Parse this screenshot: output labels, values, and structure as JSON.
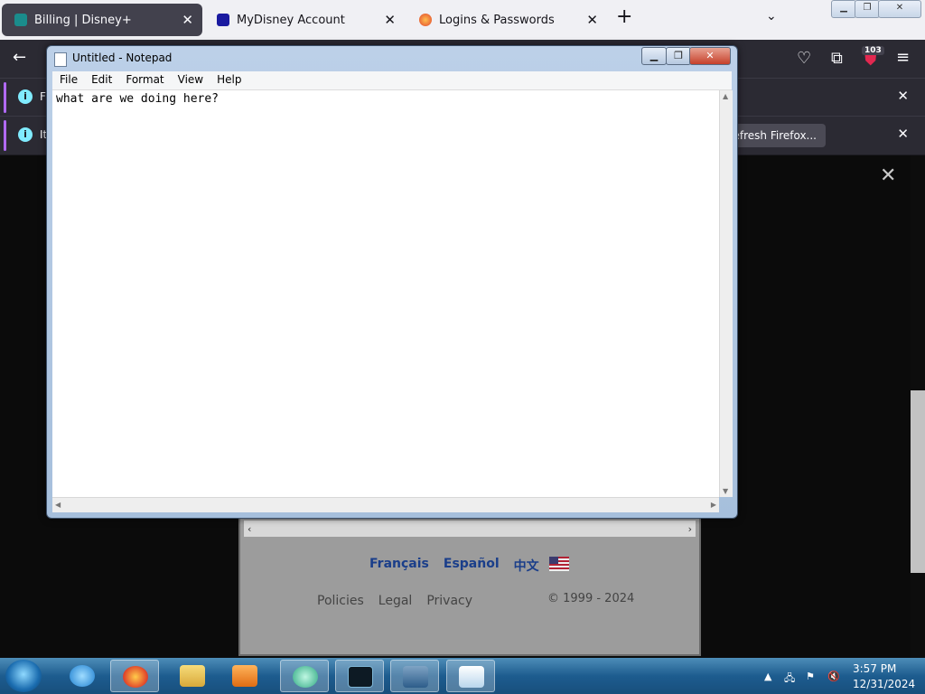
{
  "browser": {
    "tabs": [
      {
        "title": "Billing | Disney+",
        "active": true
      },
      {
        "title": "MyDisney Account",
        "active": false
      },
      {
        "title": "Logins & Passwords",
        "active": false
      }
    ],
    "new_tab": "+",
    "tab_list": "⌄",
    "extension_badge": "103",
    "notifications": [
      {
        "text": "F"
      },
      {
        "text": "It",
        "button": "Refresh Firefox..."
      }
    ]
  },
  "page": {
    "languages": [
      "Français",
      "Español",
      "中文"
    ],
    "links": [
      "Policies",
      "Legal",
      "Privacy"
    ],
    "copyright": "© 1999 - 2024"
  },
  "notepad": {
    "title": "Untitled - Notepad",
    "menu": [
      "File",
      "Edit",
      "Format",
      "View",
      "Help"
    ],
    "content": "what are we doing here?"
  },
  "taskbar": {
    "time": "3:57 PM",
    "date": "12/31/2024",
    "apps": [
      "internet-explorer",
      "firefox",
      "file-explorer",
      "media-player",
      "app-green",
      "app-house",
      "app-shield",
      "notepad"
    ]
  },
  "colors": {
    "browser_dark": "#2b2a33",
    "tabbar": "#f0f0f4",
    "taskbar": "#1d5c8f",
    "link_blue": "#1a3e8a"
  }
}
